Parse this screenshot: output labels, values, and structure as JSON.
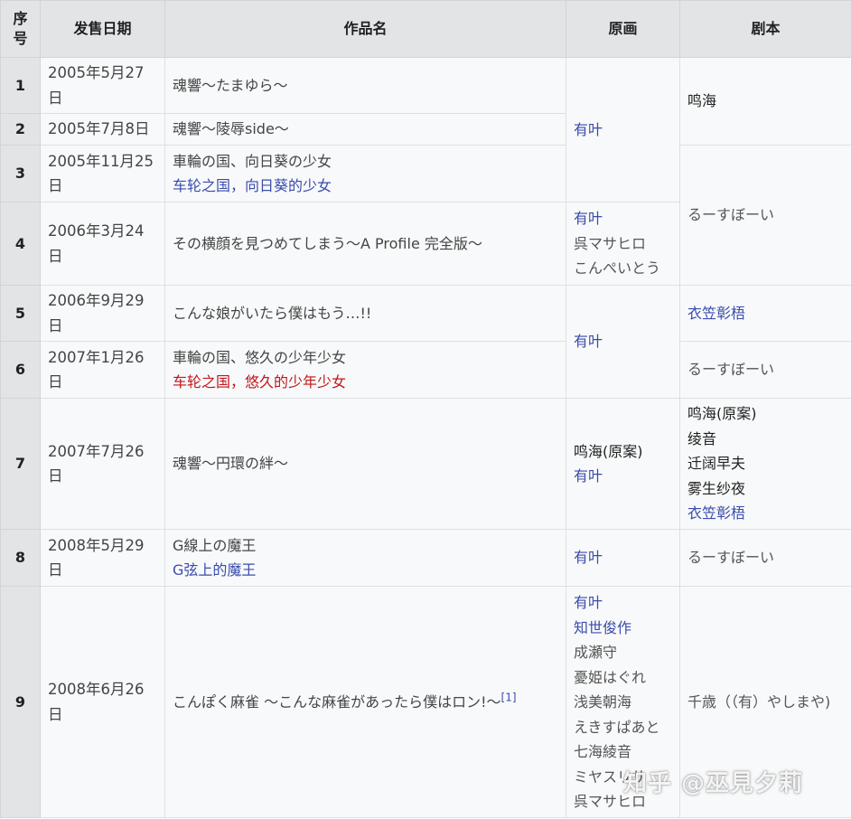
{
  "headers": {
    "index_line1": "序",
    "index_line2": "号",
    "date": "发售日期",
    "title": "作品名",
    "art": "原画",
    "script": "剧本"
  },
  "rows": [
    {
      "no": "1",
      "date": "2005年5月27日",
      "title": "魂響～たまゆら～"
    },
    {
      "no": "2",
      "date": "2005年7月8日",
      "title": "魂響～陵辱side～"
    },
    {
      "no": "3",
      "date": "2005年11月25日",
      "title": "車輪の国、向日葵の少女",
      "title_cn": "车轮之国，向日葵的少女"
    },
    {
      "no": "4",
      "date": "2006年3月24日",
      "title": "その横顔を見つめてしまう～A Profile 完全版～"
    },
    {
      "no": "5",
      "date": "2006年9月29日",
      "title": "こんな娘がいたら僕はもう…!!"
    },
    {
      "no": "6",
      "date": "2007年1月26日",
      "title": "車輪の国、悠久の少年少女",
      "title_cn": "车轮之国，悠久的少年少女"
    },
    {
      "no": "7",
      "date": "2007年7月26日",
      "title": "魂響～円環の絆～"
    },
    {
      "no": "8",
      "date": "2008年5月29日",
      "title": "G線上の魔王",
      "title_cn": "G弦上的魔王"
    },
    {
      "no": "9",
      "date": "2008年6月26日",
      "title": "こんぽく麻雀 ～こんな麻雀があったら僕はロン!～",
      "cite": "[1]"
    }
  ],
  "art": {
    "a": "有叶",
    "b": [
      "有叶",
      "呉マサヒロ",
      "こんぺいとう"
    ],
    "c": "有叶",
    "d": [
      "鸣海(原案)",
      "有叶"
    ],
    "e": "有叶",
    "f": [
      "有叶",
      "知世俊作",
      "成瀬守",
      "憂姫はぐれ",
      "浅美朝海",
      "えきすぱあと",
      "七海綾音",
      "ミヤスリサ",
      "呉マサヒロ"
    ]
  },
  "script": {
    "a": "鸣海",
    "b": "るーすぼーい",
    "c": "衣笠彰梧",
    "d": "るーすぼーい",
    "e": [
      "鸣海(原案)",
      "绫音",
      "迁阔早夫",
      "雾生纱夜",
      "衣笠彰梧"
    ],
    "f": "るーすぼーい",
    "g": "千歳（（有）やしまや)"
  },
  "watermark": "知乎 @巫見夕莉"
}
